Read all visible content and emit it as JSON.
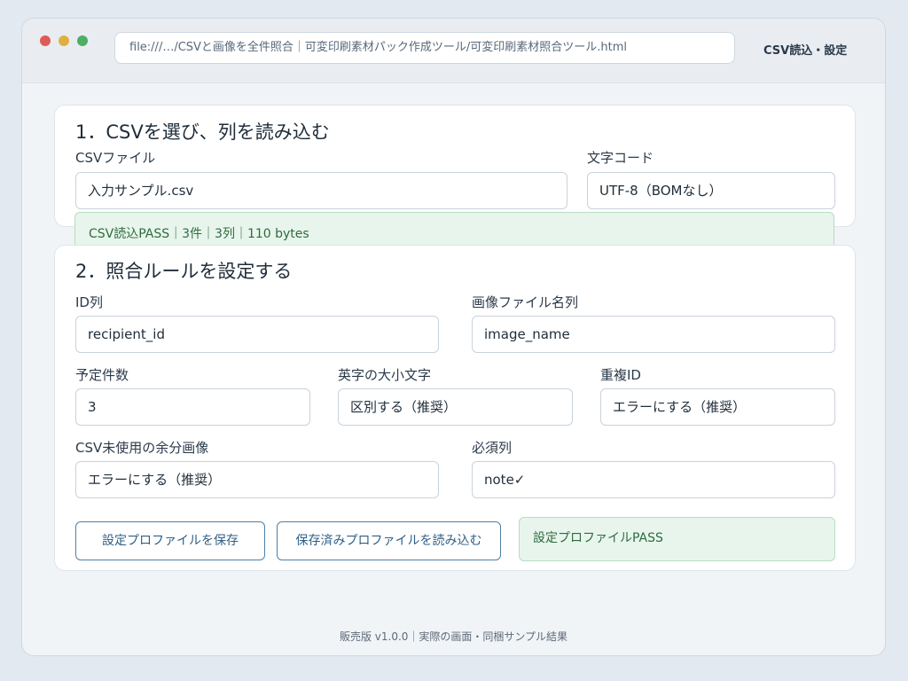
{
  "browser": {
    "address": "file:///…/CSVと画像を全件照合｜可変印刷素材パック作成ツール/可変印刷素材照合ツール.html",
    "tab_title": "CSV読込・設定"
  },
  "section1": {
    "title": "1．CSVを選び、列を読み込む",
    "csv_file_label": "CSVファイル",
    "csv_file_value": "入力サンプル.csv",
    "encoding_label": "文字コード",
    "encoding_value": "UTF-8（BOMなし）",
    "status": "CSV読込PASS｜3件｜3列｜110 bytes"
  },
  "section2": {
    "title": "2．照合ルールを設定する",
    "id_col_label": "ID列",
    "id_col_value": "recipient_id",
    "image_col_label": "画像ファイル名列",
    "image_col_value": "image_name",
    "count_label": "予定件数",
    "count_value": "3",
    "case_label": "英字の大小文字",
    "case_value": "区別する（推奨）",
    "dup_label": "重複ID",
    "dup_value": "エラーにする（推奨）",
    "extra_label": "CSV未使用の余分画像",
    "extra_value": "エラーにする（推奨）",
    "required_label": "必須列",
    "required_value": "note✓",
    "save_button": "設定プロファイルを保存",
    "load_button": "保存済みプロファイルを読み込む",
    "profile_status": "設定プロファイルPASS"
  },
  "footer": "販売版 v1.0.0｜実際の画面・同梱サンプル結果"
}
